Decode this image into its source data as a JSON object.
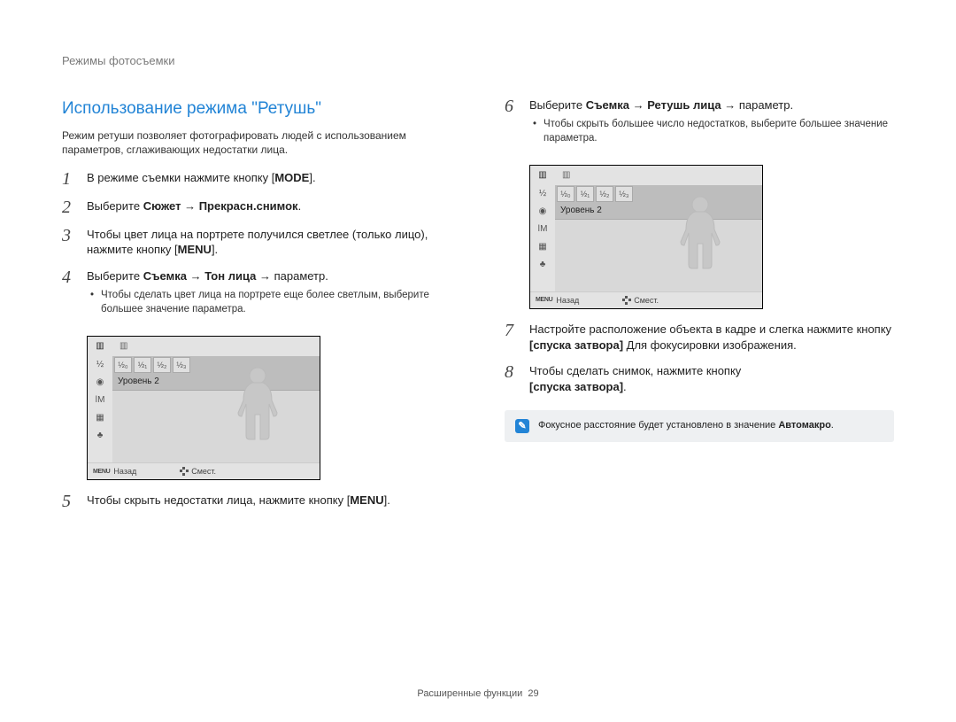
{
  "header": "Режимы фотосъемки",
  "title": "Использование режима \"Ретушь\"",
  "intro": "Режим ретуши позволяет фотографировать людей с использованием параметров, сглаживающих недостатки лица.",
  "steps": {
    "1": {
      "num": "1",
      "pre": "В режиме съемки нажмите кнопку [",
      "btn": "MODE",
      "post": "]."
    },
    "2": {
      "num": "2",
      "pre": "Выберите ",
      "strong": "Сюжет → Прекрасн.снимок",
      "post": "."
    },
    "3": {
      "num": "3",
      "pre": "Чтобы цвет лица на портрете получился светлее (только лицо), нажмите кнопку [",
      "btn": "MENU",
      "post": "]."
    },
    "4": {
      "num": "4",
      "pre": "Выберите ",
      "strong": "Съемка → Тон лица",
      "post": " → параметр.",
      "sub": "Чтобы сделать цвет лица на портрете еще более светлым, выберите большее значение параметра."
    },
    "5": {
      "num": "5",
      "pre": "Чтобы скрыть недостатки лица, нажмите кнопку [",
      "btn": "MENU",
      "post": "]."
    },
    "6": {
      "num": "6",
      "pre": "Выберите ",
      "strong": "Съемка → Ретушь лица",
      "post": " → параметр.",
      "sub": "Чтобы скрыть большее число недостатков, выберите большее значение параметра."
    },
    "7": {
      "num": "7",
      "pre": "Настройте расположение объекта в кадре и слегка нажмите кнопку ",
      "bold": "[спуска затвора]",
      "post": " Для фокусировки изображения."
    },
    "8": {
      "num": "8",
      "pre": "Чтобы сделать снимок, нажмите кнопку",
      "bold": "[спуска затвора]",
      "post": "."
    }
  },
  "camui": {
    "level_label": "Уровень 2",
    "opt0": "½₀",
    "opt1": "½₁",
    "opt2": "½₂",
    "opt3": "½₃",
    "footer_menu": "MENU",
    "footer_back": "Назад",
    "footer_move": "Смест.",
    "side_icon1": "½",
    "side_icon2": "◉",
    "side_icon3": "ǀM",
    "side_icon4": "▦",
    "side_icon5": "♣",
    "top_icon1": "▥",
    "top_icon2": "▥"
  },
  "note": {
    "pre": "Фокусное расстояние будет установлено в значение ",
    "strong": "Автомакро",
    "post": "."
  },
  "footer": {
    "text": "Расширенные функции",
    "page": "29"
  }
}
